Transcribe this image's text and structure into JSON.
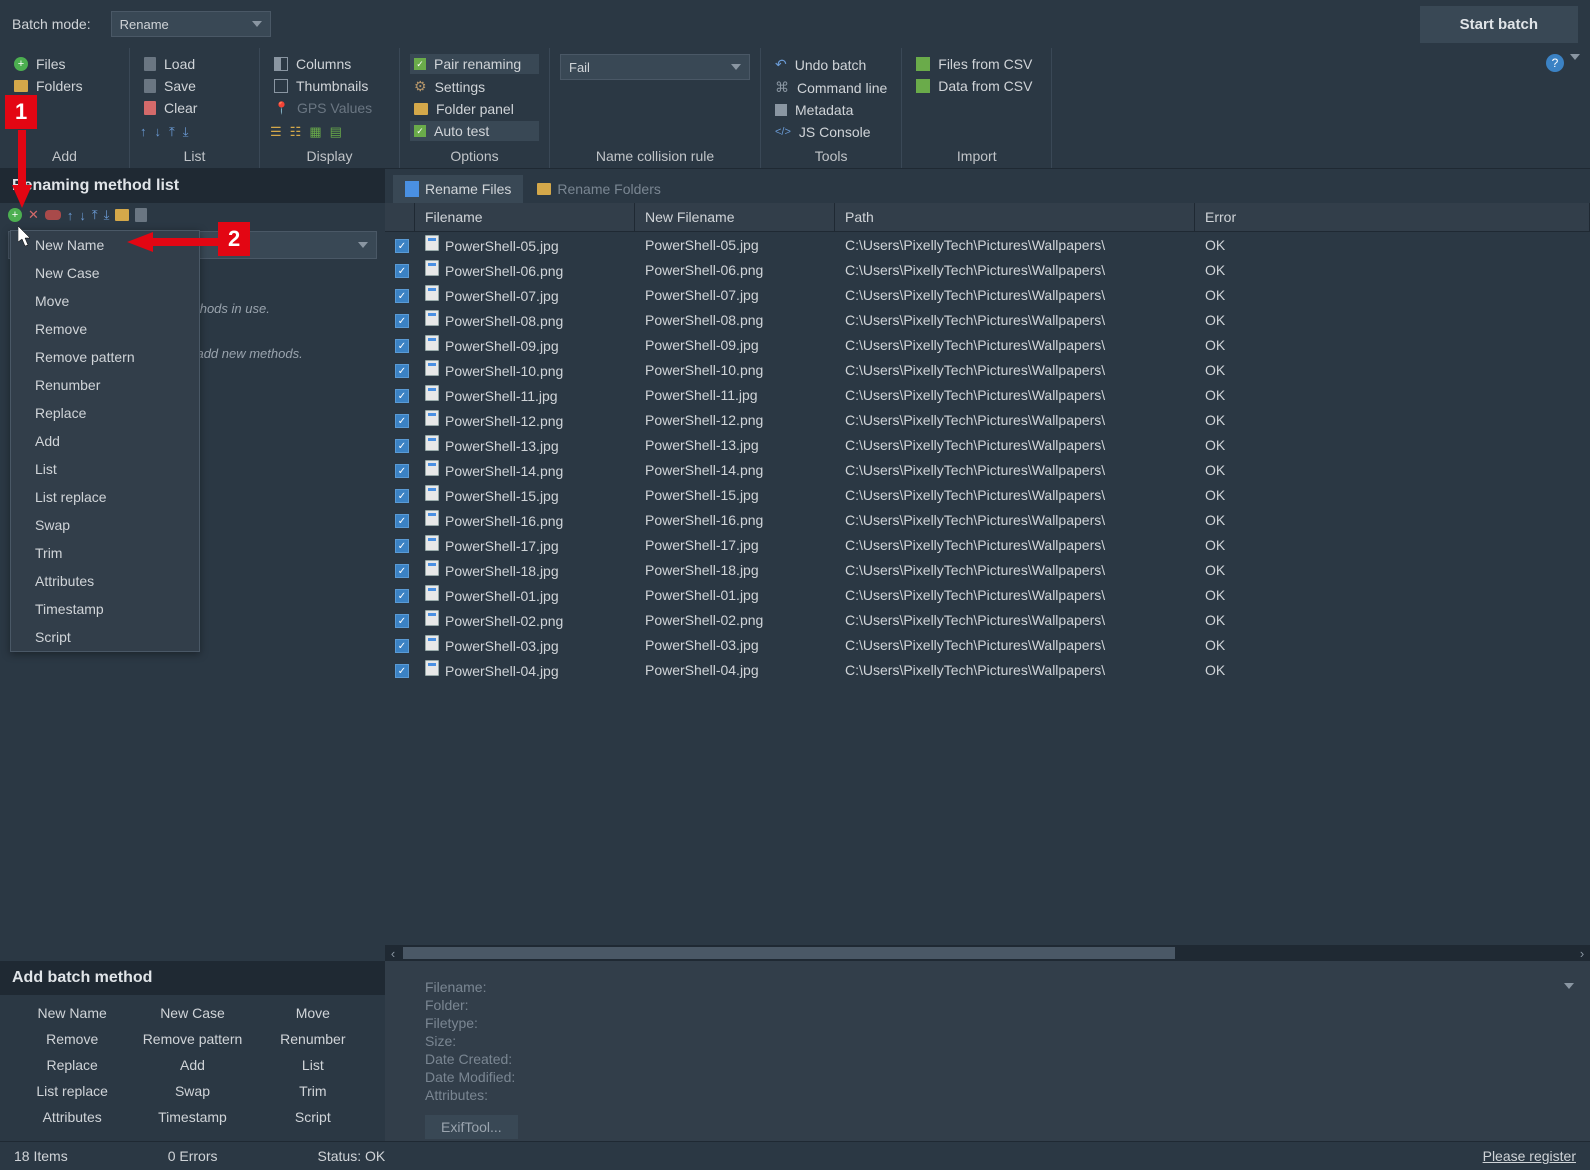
{
  "top": {
    "batch_mode_label": "Batch mode:",
    "batch_mode_value": "Rename",
    "start_batch": "Start batch"
  },
  "ribbon": {
    "add": {
      "files": "Files",
      "folders": "Folders",
      "label": "Add"
    },
    "list": {
      "load": "Load",
      "save": "Save",
      "clear": "Clear",
      "label": "List"
    },
    "display": {
      "columns": "Columns",
      "thumbnails": "Thumbnails",
      "gps": "GPS Values",
      "label": "Display"
    },
    "options": {
      "pair": "Pair renaming",
      "settings": "Settings",
      "folderpanel": "Folder panel",
      "autotest": "Auto test",
      "label": "Options"
    },
    "collision": {
      "value": "Fail",
      "label": "Name collision rule"
    },
    "tools": {
      "undo": "Undo batch",
      "cmd": "Command line",
      "meta": "Metadata",
      "js": "JS Console",
      "label": "Tools"
    },
    "import": {
      "files_csv": "Files from CSV",
      "data_csv": "Data from CSV",
      "label": "Import"
    }
  },
  "left": {
    "header": "Renaming method list",
    "empty1": "No renaming methods in use.",
    "empty2": "Click + above to add new methods.",
    "context_menu": [
      "New Name",
      "New Case",
      "Move",
      "Remove",
      "Remove pattern",
      "Renumber",
      "Replace",
      "Add",
      "List",
      "List replace",
      "Swap",
      "Trim",
      "Attributes",
      "Timestamp",
      "Script"
    ]
  },
  "tabs": {
    "rename_files": "Rename Files",
    "rename_folders": "Rename Folders"
  },
  "table": {
    "headers": {
      "filename": "Filename",
      "newfile": "New Filename",
      "path": "Path",
      "error": "Error"
    },
    "path": "C:\\Users\\PixellyTech\\Pictures\\Wallpapers\\",
    "ok": "OK",
    "rows": [
      {
        "f": "PowerShell-05.jpg"
      },
      {
        "f": "PowerShell-06.png"
      },
      {
        "f": "PowerShell-07.jpg"
      },
      {
        "f": "PowerShell-08.png"
      },
      {
        "f": "PowerShell-09.jpg"
      },
      {
        "f": "PowerShell-10.png"
      },
      {
        "f": "PowerShell-11.jpg"
      },
      {
        "f": "PowerShell-12.png"
      },
      {
        "f": "PowerShell-13.jpg"
      },
      {
        "f": "PowerShell-14.png"
      },
      {
        "f": "PowerShell-15.jpg"
      },
      {
        "f": "PowerShell-16.png"
      },
      {
        "f": "PowerShell-17.jpg"
      },
      {
        "f": "PowerShell-18.jpg"
      },
      {
        "f": "PowerShell-01.jpg"
      },
      {
        "f": "PowerShell-02.png"
      },
      {
        "f": "PowerShell-03.jpg"
      },
      {
        "f": "PowerShell-04.jpg"
      }
    ]
  },
  "bottom": {
    "header": "Add batch method",
    "items": [
      "New Name",
      "New Case",
      "Move",
      "Remove",
      "Remove pattern",
      "Renumber",
      "Replace",
      "Add",
      "List",
      "List replace",
      "Swap",
      "Trim",
      "Attributes",
      "Timestamp",
      "Script"
    ]
  },
  "detail": {
    "filename": "Filename:",
    "folder": "Folder:",
    "filetype": "Filetype:",
    "size": "Size:",
    "created": "Date Created:",
    "modified": "Date Modified:",
    "attributes": "Attributes:",
    "exif": "ExifTool..."
  },
  "status": {
    "items": "18 Items",
    "errors": "0 Errors",
    "status": "Status: OK",
    "register": "Please register"
  },
  "annotations": {
    "one": "1",
    "two": "2"
  }
}
